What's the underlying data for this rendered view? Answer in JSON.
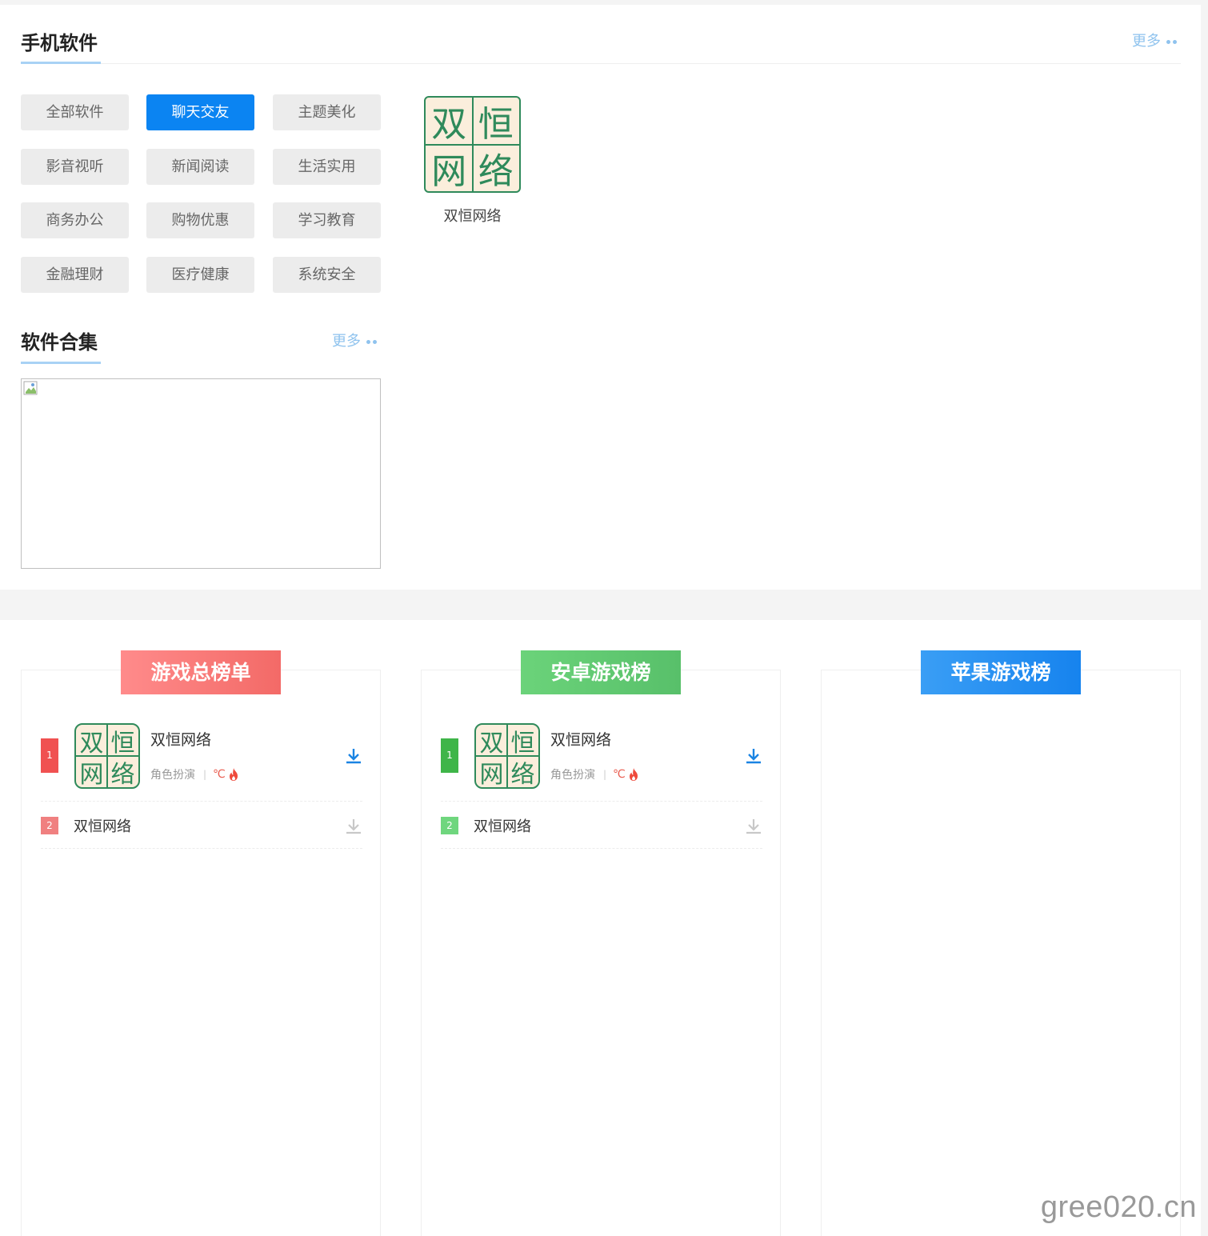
{
  "mobile_software": {
    "title": "手机软件",
    "more_label": "更多",
    "categories": [
      {
        "label": "全部软件",
        "active": false
      },
      {
        "label": "聊天交友",
        "active": true
      },
      {
        "label": "主题美化",
        "active": false
      },
      {
        "label": "影音视听",
        "active": false
      },
      {
        "label": "新闻阅读",
        "active": false
      },
      {
        "label": "生活实用",
        "active": false
      },
      {
        "label": "商务办公",
        "active": false
      },
      {
        "label": "购物优惠",
        "active": false
      },
      {
        "label": "学习教育",
        "active": false
      },
      {
        "label": "金融理财",
        "active": false
      },
      {
        "label": "医疗健康",
        "active": false
      },
      {
        "label": "系统安全",
        "active": false
      }
    ],
    "featured_app": {
      "name": "双恒网络",
      "logo_chars": [
        "双",
        "恒",
        "网",
        "络"
      ]
    }
  },
  "software_collection": {
    "title": "软件合集",
    "more_label": "更多"
  },
  "rankings": [
    {
      "title": "游戏总榜单",
      "color": "#f05151",
      "items": [
        {
          "rank": "1",
          "name": "双恒网络",
          "category": "角色扮演",
          "heat": "℃"
        },
        {
          "rank": "2",
          "name": "双恒网络"
        }
      ]
    },
    {
      "title": "安卓游戏榜",
      "color": "#3fb549",
      "items": [
        {
          "rank": "1",
          "name": "双恒网络",
          "category": "角色扮演",
          "heat": "℃"
        },
        {
          "rank": "2",
          "name": "双恒网络"
        }
      ]
    },
    {
      "title": "苹果游戏榜",
      "color": "#1683ee",
      "items": []
    }
  ],
  "watermark": "gree020.cn",
  "colors": {
    "accent_blue": "#0b84f2",
    "more_link": "#8fc3ee",
    "logo_green": "#2f8a5b",
    "logo_bg": "#fbeedc",
    "download_blue": "#1a84e3",
    "download_grey": "#c8c8c8"
  },
  "icons": [
    "dots-icon",
    "download-icon",
    "fire-icon",
    "broken-image-icon"
  ]
}
